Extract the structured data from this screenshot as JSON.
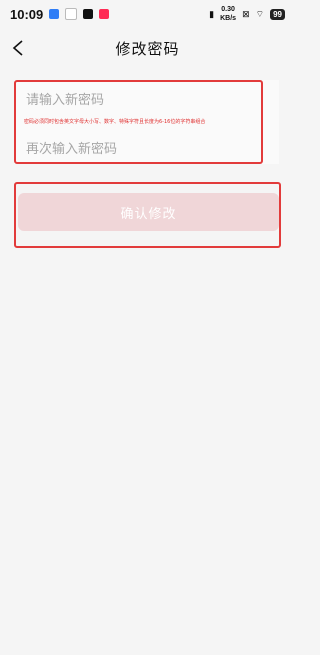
{
  "status_bar": {
    "time": "10:09",
    "netspeed_value": "0.30",
    "netspeed_unit": "KB/s",
    "battery": "99",
    "app_icons": [
      "app-icon-blue",
      "app-icon-white",
      "tiktok-icon",
      "red-app-icon"
    ]
  },
  "nav": {
    "title": "修改密码"
  },
  "form": {
    "new_password_placeholder": "请输入新密码",
    "hint": "密码必须同时包含英文字母大小写、数字、特殊字符且长度为6-16位的字符串组合",
    "confirm_password_placeholder": "再次输入新密码",
    "submit_label": "确认修改"
  },
  "colors": {
    "accent_red": "#e23b3b",
    "button_disabled": "#f0d6d8"
  }
}
